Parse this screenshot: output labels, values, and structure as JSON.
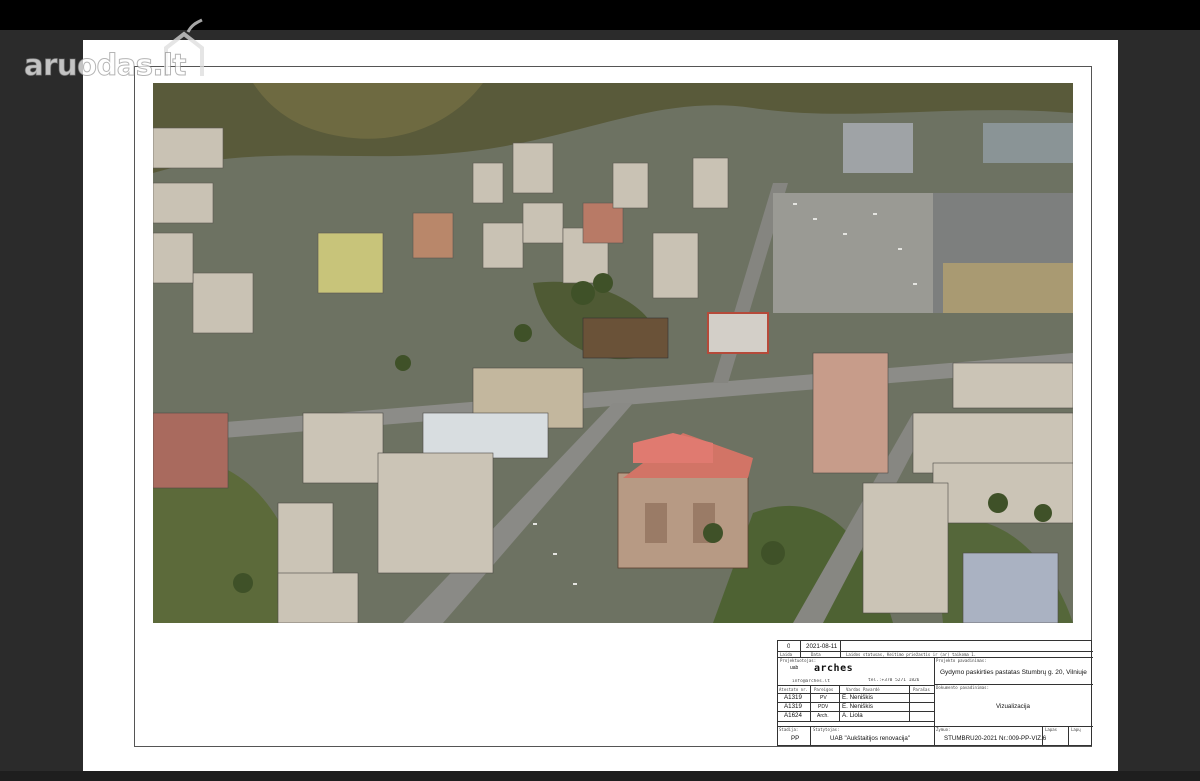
{
  "watermark": {
    "text": "aruodas.lt"
  },
  "colors": {
    "background": "#2b2b2b",
    "sheet": "#ffffff",
    "topbar": "#000000"
  },
  "title_block": {
    "revision": {
      "no": "0",
      "date": "2021-08-11",
      "no_label": "Laida",
      "date_label": "Data",
      "status_label": "Laidos statusas, Keitimo priežastis ir (ar) taikoma 1."
    },
    "designer_label": "Projektuotojas:",
    "logo_prefix": "uab",
    "logo_name": "arches",
    "email": "info@arches.lt",
    "phone": "tel.:+370 5271 1826",
    "project_title_label": "Projekto pavadinimas:",
    "project_title": "Gydymo paskirties pastatas Stumbrų g. 20, Vilniuje",
    "doc_title_label": "Dokumento pavadinimas:",
    "doc_title": "Vizualizacija",
    "staff_headers": {
      "cert": "Atestato nr.",
      "role": "Pareigos",
      "name": "Vardas Pavardė",
      "sign": "Parašas"
    },
    "staff": [
      {
        "cert": "A1319",
        "role": "PV",
        "name": "E. Neniškis"
      },
      {
        "cert": "A1319",
        "role": "PDV",
        "name": "E. Neniškis"
      },
      {
        "cert": "A1624",
        "role": "Arch.",
        "name": "A. Liola"
      }
    ],
    "stage_label": "Stadija:",
    "stage": "PP",
    "client_label": "Statytojas:",
    "client": "UAB \"Aukštaitijos renovacija\"",
    "code_label": "Žymuo:",
    "code": "STUMBRU20-2021 Nr.:009-PP-VIZ.6",
    "sheet_label": "Lapas",
    "sheets_label": "Lapų"
  }
}
